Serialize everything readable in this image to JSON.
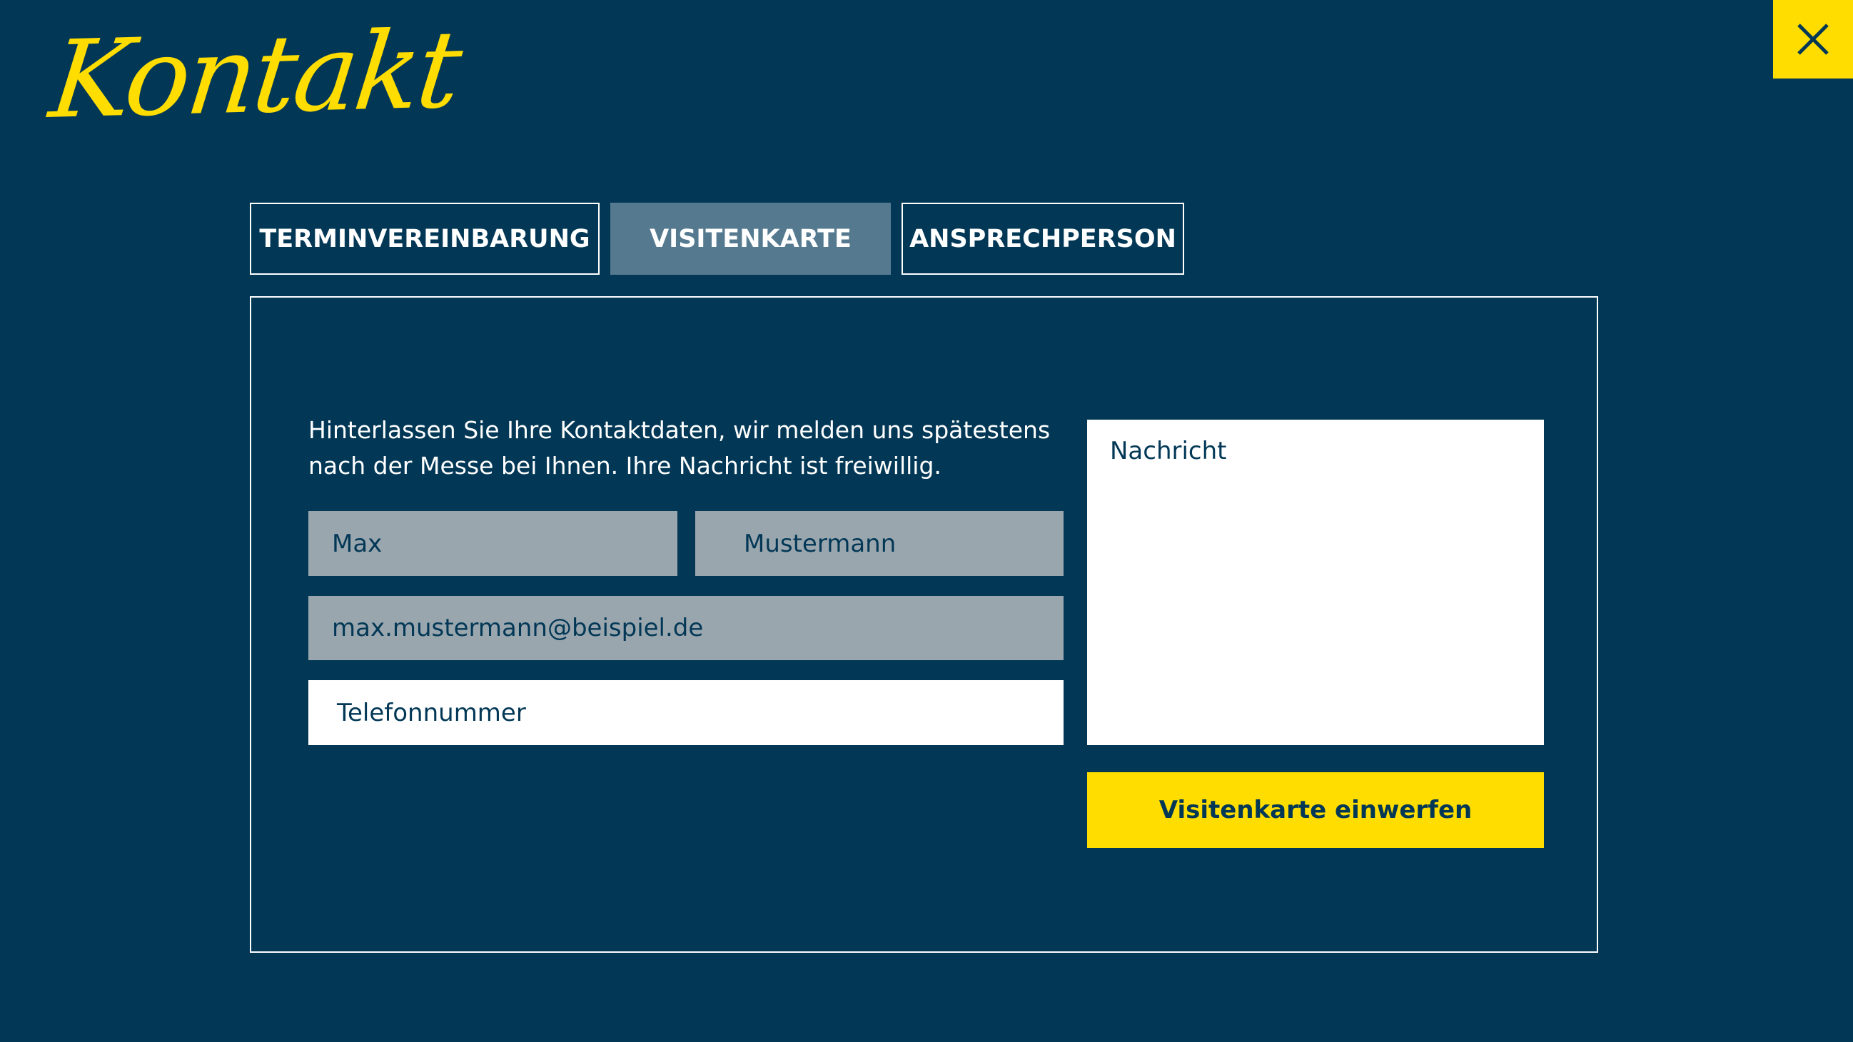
{
  "header": {
    "title": "Kontakt",
    "close_icon": "close-icon"
  },
  "colors": {
    "background": "#023856",
    "accent": "#ffdd00",
    "active_tab": "#557a90",
    "filled_input": "#9aa6ae",
    "text_on_light": "#023856"
  },
  "tabs": [
    {
      "label": "TERMINVEREINBARUNG",
      "active": false
    },
    {
      "label": "VISITENKARTE",
      "active": true
    },
    {
      "label": "ANSPRECHPERSON",
      "active": false
    }
  ],
  "form": {
    "intro_text": "Hinterlassen Sie Ihre Kontaktdaten, wir melden uns spätestens nach der Messe bei Ihnen. Ihre Nachricht ist freiwillig.",
    "first_name": "Max",
    "last_name": "Mustermann",
    "email": "max.mustermann@beispiel.de",
    "phone_placeholder": "Telefonnummer",
    "message_placeholder": "Nachricht",
    "submit_label": "Visitenkarte einwerfen"
  }
}
